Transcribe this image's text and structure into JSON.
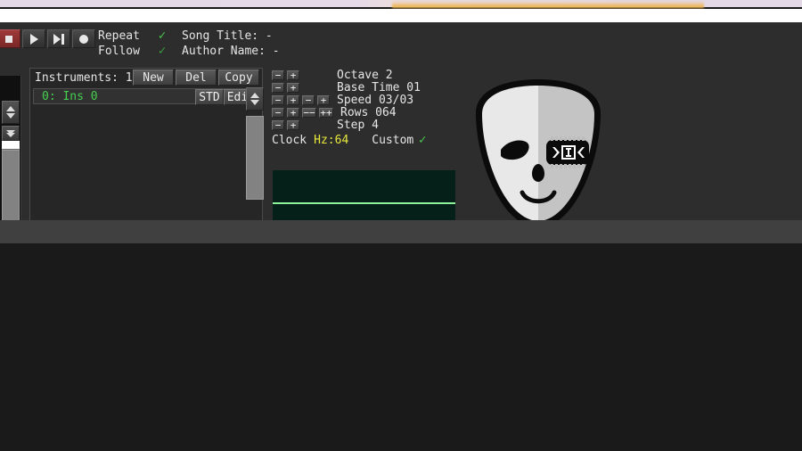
{
  "window": {
    "chrome_accent_color": "#eeb75c",
    "chrome_band_color": "#e2d8e6",
    "app_background": "#2d2d2d"
  },
  "transport": {
    "buttons": [
      {
        "name": "stop",
        "icon": "stop-icon",
        "label": "Stop",
        "active": true
      },
      {
        "name": "play",
        "icon": "play-icon",
        "label": "Play",
        "active": false
      },
      {
        "name": "play-from-cursor",
        "icon": "play-to-end-icon",
        "label": "Play From Cursor",
        "active": false
      },
      {
        "name": "record",
        "icon": "record-icon",
        "label": "Record",
        "active": false
      }
    ]
  },
  "header": {
    "repeat_label": "Repeat",
    "repeat_checked": "✓",
    "follow_label": "Follow",
    "follow_checked": "✓",
    "song_title_label": "Song Title: -",
    "author_name_label": "Author Name: -"
  },
  "instruments": {
    "count_label": "Instruments: 1",
    "new_label": "New",
    "del_label": "Del",
    "copy_label": "Copy",
    "rows": [
      {
        "name": "0: Ins 0",
        "std_label": "STD",
        "edit_label": "Edit"
      }
    ]
  },
  "settings": {
    "minus": "−",
    "plus": "+",
    "minus2": "−−",
    "plus2": "++",
    "rows": [
      {
        "label": "Octave 2",
        "has_second_pair": false
      },
      {
        "label": "Base Time 01",
        "has_second_pair": false
      },
      {
        "label": "Speed 03/03",
        "has_second_pair": true
      },
      {
        "label": "Rows 064",
        "has_second_pair": true
      },
      {
        "label": "Step 4",
        "has_second_pair": false
      }
    ],
    "clock_label": "Clock",
    "clock_value": "Hz:64",
    "clock_value_color": "#e8e83c",
    "custom_label": "Custom",
    "custom_checked": "✓"
  },
  "scopes": {
    "top_name": "oscilloscope-top",
    "bottom_name": "oscilloscope-bottom",
    "background_color": "#042018",
    "line_color": "#8ef29a"
  },
  "logo": {
    "name": "mask-logo",
    "eye_chip_glyph": ">▣<",
    "face_light": "#e8e8e8",
    "face_shade": "#c4c4c4",
    "outline": "#0b0b0b"
  }
}
